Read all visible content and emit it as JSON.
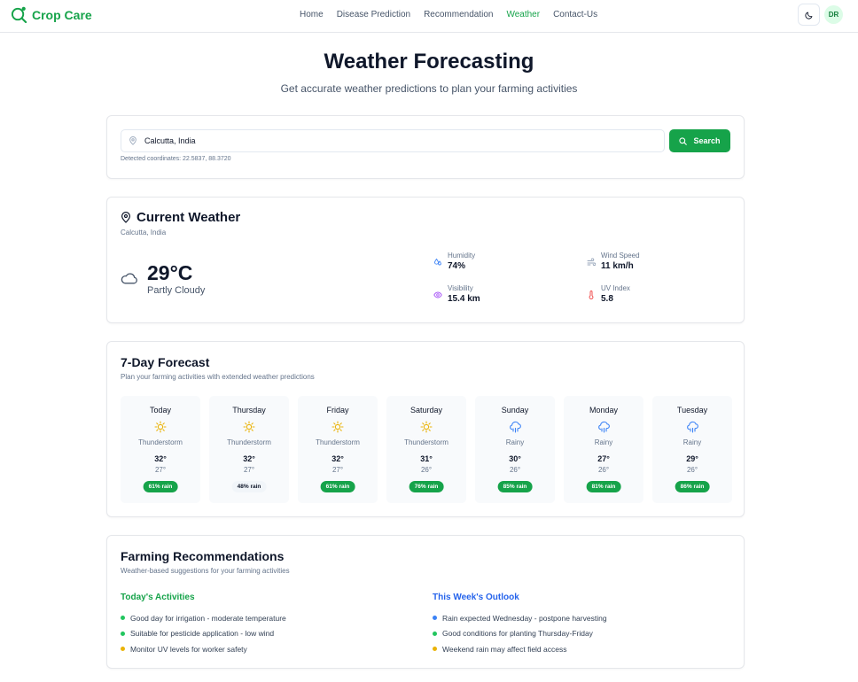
{
  "app": {
    "name": "Crop Care",
    "user_initials": "DR"
  },
  "nav": {
    "items": [
      {
        "label": "Home",
        "active": false
      },
      {
        "label": "Disease Prediction",
        "active": false
      },
      {
        "label": "Recommendation",
        "active": false
      },
      {
        "label": "Weather",
        "active": true
      },
      {
        "label": "Contact-Us",
        "active": false
      }
    ]
  },
  "hero": {
    "title": "Weather Forecasting",
    "subtitle": "Get accurate weather predictions to plan your farming activities"
  },
  "search": {
    "value": "Calcutta, India",
    "button_label": "Search",
    "coordinates_text": "Detected coordinates: 22.5837, 88.3720"
  },
  "current": {
    "title": "Current Weather",
    "location": "Calcutta, India",
    "temperature": "29°C",
    "condition": "Partly Cloudy",
    "condition_icon": "cloud-icon",
    "stats": {
      "humidity": {
        "label": "Humidity",
        "value": "74%",
        "icon": "droplets-icon"
      },
      "wind": {
        "label": "Wind Speed",
        "value": "11 km/h",
        "icon": "wind-icon"
      },
      "visibility": {
        "label": "Visibility",
        "value": "15.4 km",
        "icon": "eye-icon"
      },
      "uv": {
        "label": "UV Index",
        "value": "5.8",
        "icon": "thermometer-icon"
      }
    }
  },
  "forecast": {
    "title": "7-Day Forecast",
    "subtitle": "Plan your farming activities with extended weather predictions",
    "days": [
      {
        "day": "Today",
        "condition": "Thunderstorm",
        "icon": "sun-icon",
        "high": "32°",
        "low": "27°",
        "rain": "61% rain",
        "rain_level": "high"
      },
      {
        "day": "Thursday",
        "condition": "Thunderstorm",
        "icon": "sun-icon",
        "high": "32°",
        "low": "27°",
        "rain": "48% rain",
        "rain_level": "low"
      },
      {
        "day": "Friday",
        "condition": "Thunderstorm",
        "icon": "sun-icon",
        "high": "32°",
        "low": "27°",
        "rain": "61% rain",
        "rain_level": "high"
      },
      {
        "day": "Saturday",
        "condition": "Thunderstorm",
        "icon": "sun-icon",
        "high": "31°",
        "low": "26°",
        "rain": "76% rain",
        "rain_level": "high"
      },
      {
        "day": "Sunday",
        "condition": "Rainy",
        "icon": "cloud-rain-icon",
        "high": "30°",
        "low": "26°",
        "rain": "85% rain",
        "rain_level": "high"
      },
      {
        "day": "Monday",
        "condition": "Rainy",
        "icon": "cloud-rain-icon",
        "high": "27°",
        "low": "26°",
        "rain": "81% rain",
        "rain_level": "high"
      },
      {
        "day": "Tuesday",
        "condition": "Rainy",
        "icon": "cloud-rain-icon",
        "high": "29°",
        "low": "26°",
        "rain": "86% rain",
        "rain_level": "high"
      }
    ]
  },
  "recommendations": {
    "title": "Farming Recommendations",
    "subtitle": "Weather-based suggestions for your farming activities",
    "today": {
      "heading": "Today's Activities",
      "color": "#16a34a",
      "items": [
        {
          "text": "Good day for irrigation - moderate temperature",
          "dot": "#22c55e"
        },
        {
          "text": "Suitable for pesticide application - low wind",
          "dot": "#22c55e"
        },
        {
          "text": "Monitor UV levels for worker safety",
          "dot": "#eab308"
        }
      ]
    },
    "week": {
      "heading": "This Week's Outlook",
      "color": "#2563eb",
      "items": [
        {
          "text": "Rain expected Wednesday - postpone harvesting",
          "dot": "#3b82f6"
        },
        {
          "text": "Good conditions for planting Thursday-Friday",
          "dot": "#22c55e"
        },
        {
          "text": "Weekend rain may affect field access",
          "dot": "#eab308"
        }
      ]
    }
  },
  "colors": {
    "brand": "#16a34a",
    "text": "#0f172a",
    "muted": "#64748b"
  }
}
